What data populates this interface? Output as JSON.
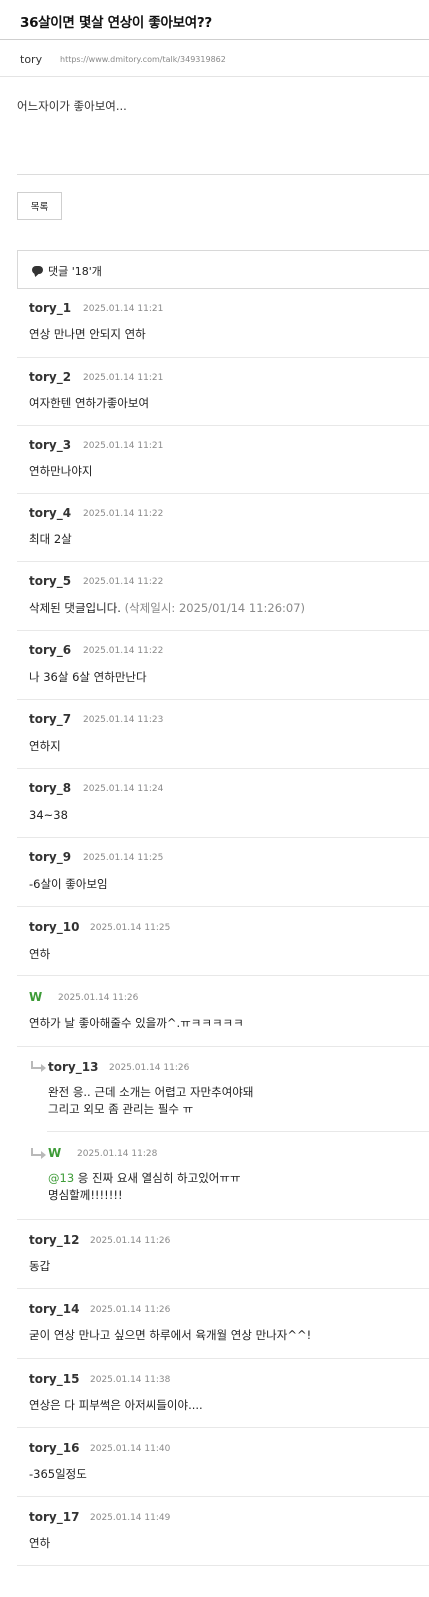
{
  "post": {
    "title": "36살이면 몇살 연상이 좋아보여??",
    "author": "tory",
    "url": "https://www.dmitory.com/talk/349319862",
    "body": "어느자이가 좋아보여..."
  },
  "list_button": "목록",
  "comments_header": "댓글 '18'개",
  "comments": [
    {
      "name": "tory_1",
      "date": "2025.01.14 11:21",
      "text": "연상 만나면 안되지 연하"
    },
    {
      "name": "tory_2",
      "date": "2025.01.14 11:21",
      "text": "여자한텐 연하가좋아보여"
    },
    {
      "name": "tory_3",
      "date": "2025.01.14 11:21",
      "text": "연하만나야지"
    },
    {
      "name": "tory_4",
      "date": "2025.01.14 11:22",
      "text": "최대 2살"
    },
    {
      "name": "tory_5",
      "date": "2025.01.14 11:22",
      "text": "삭제된 댓글입니다.",
      "deleted_note": "(삭제일시: 2025/01/14 11:26:07)"
    },
    {
      "name": "tory_6",
      "date": "2025.01.14 11:22",
      "text": "나 36살 6살 연하만난다"
    },
    {
      "name": "tory_7",
      "date": "2025.01.14 11:23",
      "text": "연하지"
    },
    {
      "name": "tory_8",
      "date": "2025.01.14 11:24",
      "text": "34~38"
    },
    {
      "name": "tory_9",
      "date": "2025.01.14 11:25",
      "text": "-6살이 좋아보임"
    },
    {
      "name": "tory_10",
      "date": "2025.01.14 11:25",
      "text": "연하"
    },
    {
      "name": "W",
      "date": "2025.01.14 11:26",
      "text": "연하가 날 좋아해줄수 있을까^.ㅠㅋㅋㅋㅋㅋ"
    },
    {
      "name": "tory_12",
      "date": "2025.01.14 11:26",
      "text": "동갑"
    },
    {
      "name": "tory_14",
      "date": "2025.01.14 11:26",
      "text": "굳이 연상 만나고 싶으면 하루에서 육개월 연상 만나자^^!"
    },
    {
      "name": "tory_15",
      "date": "2025.01.14 11:38",
      "text": "연상은 다 피부썩은 아저씨들이야...."
    },
    {
      "name": "tory_16",
      "date": "2025.01.14 11:40",
      "text": "-365일정도"
    },
    {
      "name": "tory_17",
      "date": "2025.01.14 11:49",
      "text": "연하"
    }
  ],
  "replies": [
    {
      "name": "tory_13",
      "date": "2025.01.14 11:26",
      "line1": "완전 응.. 근데 소개는 어렵고 자만추여야돼",
      "line2": "그리고 외모 좀 관리는 필수 ㅠ"
    },
    {
      "name": "W",
      "date": "2025.01.14 11:28",
      "mention": "@13",
      "line1": " 응 진짜 요새 열심히 하고있어ㅠㅠ",
      "line2": "명심할께!!!!!!!"
    }
  ]
}
